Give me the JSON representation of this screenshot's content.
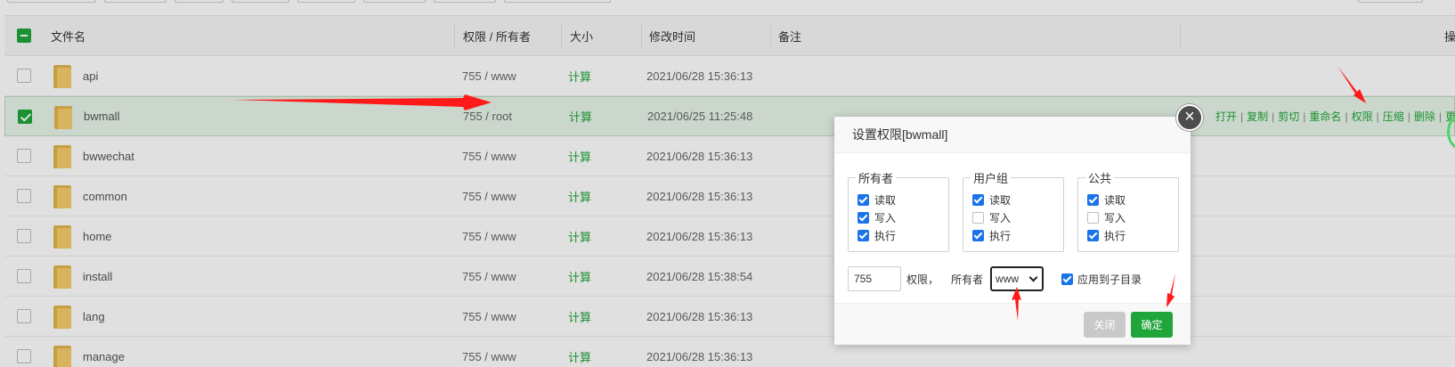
{
  "table": {
    "headers": {
      "filename": "文件名",
      "perm_owner": "权限 / 所有者",
      "size": "大小",
      "mtime": "修改时间",
      "remark": "备注",
      "ops_partial": "操"
    },
    "rows": [
      {
        "name": "api",
        "perm": "755 / www",
        "size": "计算",
        "mtime": "2021/06/28 15:36:13",
        "checked": false
      },
      {
        "name": "bwmall",
        "perm": "755 / root",
        "size": "计算",
        "mtime": "2021/06/25 11:25:48",
        "checked": true
      },
      {
        "name": "bwwechat",
        "perm": "755 / www",
        "size": "计算",
        "mtime": "2021/06/28 15:36:13",
        "checked": false
      },
      {
        "name": "common",
        "perm": "755 / www",
        "size": "计算",
        "mtime": "2021/06/28 15:36:13",
        "checked": false
      },
      {
        "name": "home",
        "perm": "755 / www",
        "size": "计算",
        "mtime": "2021/06/28 15:36:13",
        "checked": false
      },
      {
        "name": "install",
        "perm": "755 / www",
        "size": "计算",
        "mtime": "2021/06/28 15:38:54",
        "checked": false
      },
      {
        "name": "lang",
        "perm": "755 / www",
        "size": "计算",
        "mtime": "2021/06/28 15:36:13",
        "checked": false
      },
      {
        "name": "manage",
        "perm": "755 / www",
        "size": "计算",
        "mtime": "2021/06/28 15:36:13",
        "checked": false
      }
    ],
    "row_ops": [
      "打开",
      "复制",
      "剪切",
      "重命名",
      "权限",
      "压缩",
      "删除",
      "更"
    ]
  },
  "modal": {
    "title": "设置权限[bwmall]",
    "close_icon": "×",
    "groups": [
      {
        "legend": "所有者",
        "read": {
          "label": "读取",
          "checked": true
        },
        "write": {
          "label": "写入",
          "checked": true
        },
        "exec": {
          "label": "执行",
          "checked": true
        }
      },
      {
        "legend": "用户组",
        "read": {
          "label": "读取",
          "checked": true
        },
        "write": {
          "label": "写入",
          "checked": false
        },
        "exec": {
          "label": "执行",
          "checked": true
        }
      },
      {
        "legend": "公共",
        "read": {
          "label": "读取",
          "checked": true
        },
        "write": {
          "label": "写入",
          "checked": false
        },
        "exec": {
          "label": "执行",
          "checked": true
        }
      }
    ],
    "perm_value": "755",
    "perm_label": "权限，",
    "owner_label": "所有者",
    "owner_selected": "www",
    "apply_sub": "应用到子目录",
    "close_btn": "关闭",
    "ok_btn": "确定"
  },
  "colors": {
    "accent_green": "#20a53a",
    "annotation_red": "#ff1a1a"
  }
}
